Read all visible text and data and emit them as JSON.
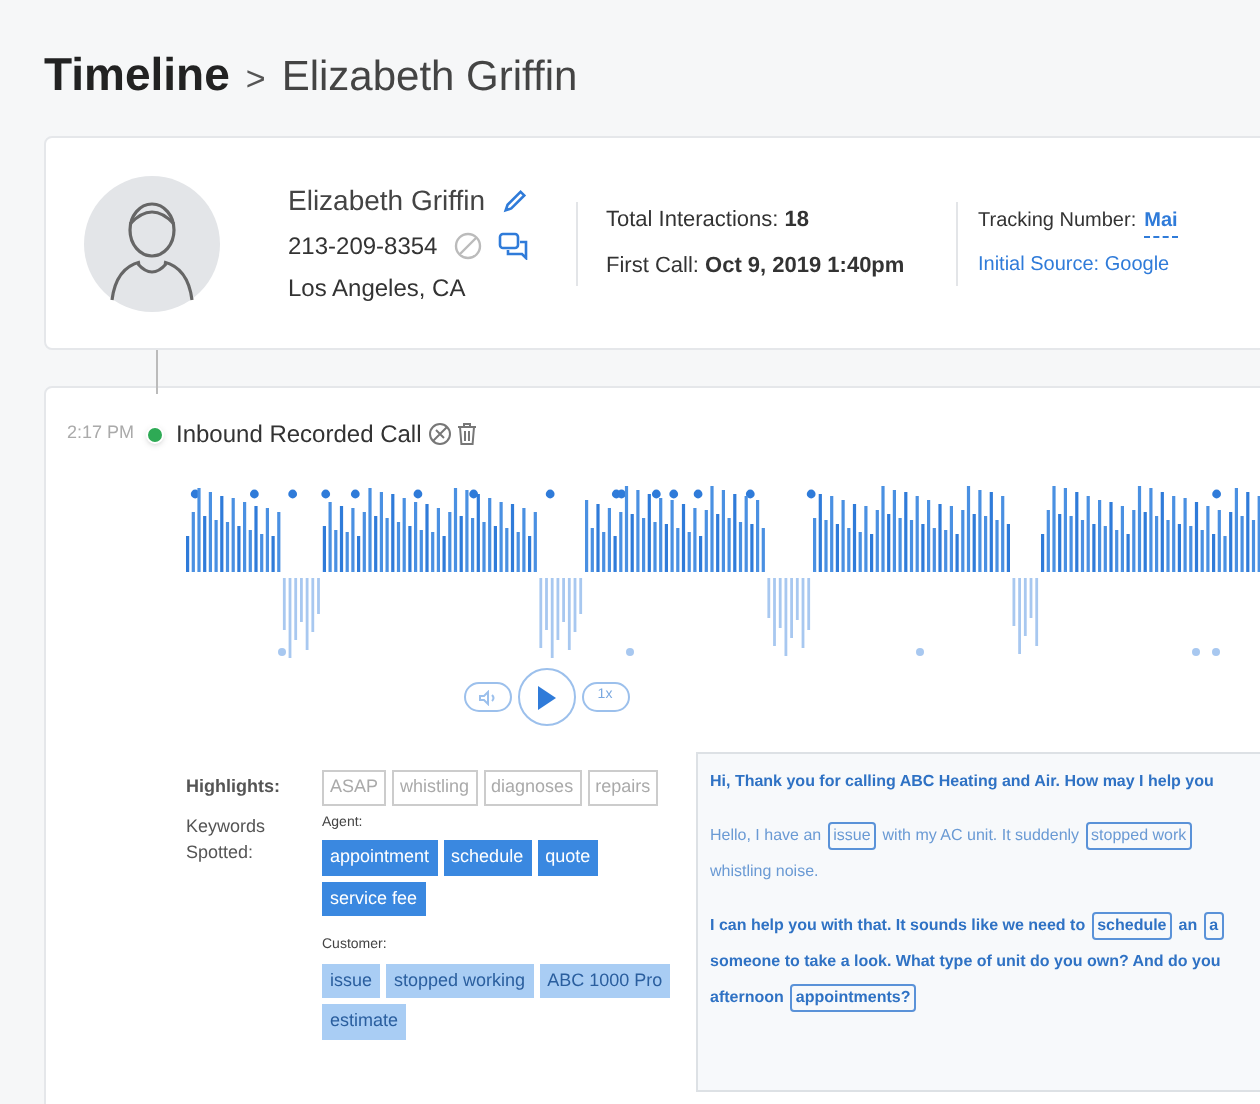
{
  "breadcrumb": {
    "root": "Timeline",
    "separator": ">",
    "current": "Elizabeth Griffin"
  },
  "contact": {
    "name": "Elizabeth Griffin",
    "phone": "213-209-8354",
    "location": "Los Angeles, CA",
    "stats": [
      {
        "label": "Total Interactions:",
        "value": "18"
      },
      {
        "label": "First Call:",
        "value": "Oct 9, 2019 1:40pm"
      }
    ],
    "tracking": {
      "label": "Tracking Number:",
      "value": "Mai"
    },
    "source": "Initial Source: Google"
  },
  "call": {
    "time": "2:17 PM",
    "title": "Inbound Recorded Call",
    "speed": "1x",
    "highlights_label": "Highlights:",
    "highlights": [
      "ASAP",
      "whistling",
      "diagnoses",
      "repairs"
    ],
    "keywords_label": "Keywords Spotted:",
    "keyword_groups": [
      {
        "kind": "agent",
        "label": "Agent:",
        "words": [
          "appointment",
          "schedule",
          "quote",
          "service fee"
        ]
      },
      {
        "kind": "customer",
        "label": "Customer:",
        "words": [
          "issue",
          "stopped working",
          "ABC 1000 Pro",
          "estimate"
        ]
      }
    ],
    "transcript": [
      {
        "kind": "agent",
        "lines": [
          [
            {
              "text": "Hi, Thank you for calling ABC Heating and Air. How may I help you",
              "boxed": false
            }
          ]
        ]
      },
      {
        "kind": "customer",
        "lines": [
          [
            {
              "text": "Hello, I have an",
              "boxed": false
            },
            {
              "text": "issue",
              "boxed": true
            },
            {
              "text": "with my AC unit. It suddenly",
              "boxed": false
            },
            {
              "text": "stopped work",
              "boxed": true
            }
          ],
          [
            {
              "text": "whistling noise.",
              "boxed": false
            }
          ]
        ]
      },
      {
        "kind": "agent",
        "lines": [
          [
            {
              "text": "I can help you with that. It sounds like we need to",
              "boxed": false
            },
            {
              "text": "schedule",
              "boxed": true
            },
            {
              "text": "an",
              "boxed": false
            },
            {
              "text": "a",
              "boxed": true
            }
          ],
          [
            {
              "text": "someone to take a look. What type of unit do you own? And do you",
              "boxed": false
            }
          ],
          [
            {
              "text": "afternoon",
              "boxed": false
            },
            {
              "text": "appointments?",
              "boxed": true
            }
          ]
        ]
      }
    ]
  }
}
